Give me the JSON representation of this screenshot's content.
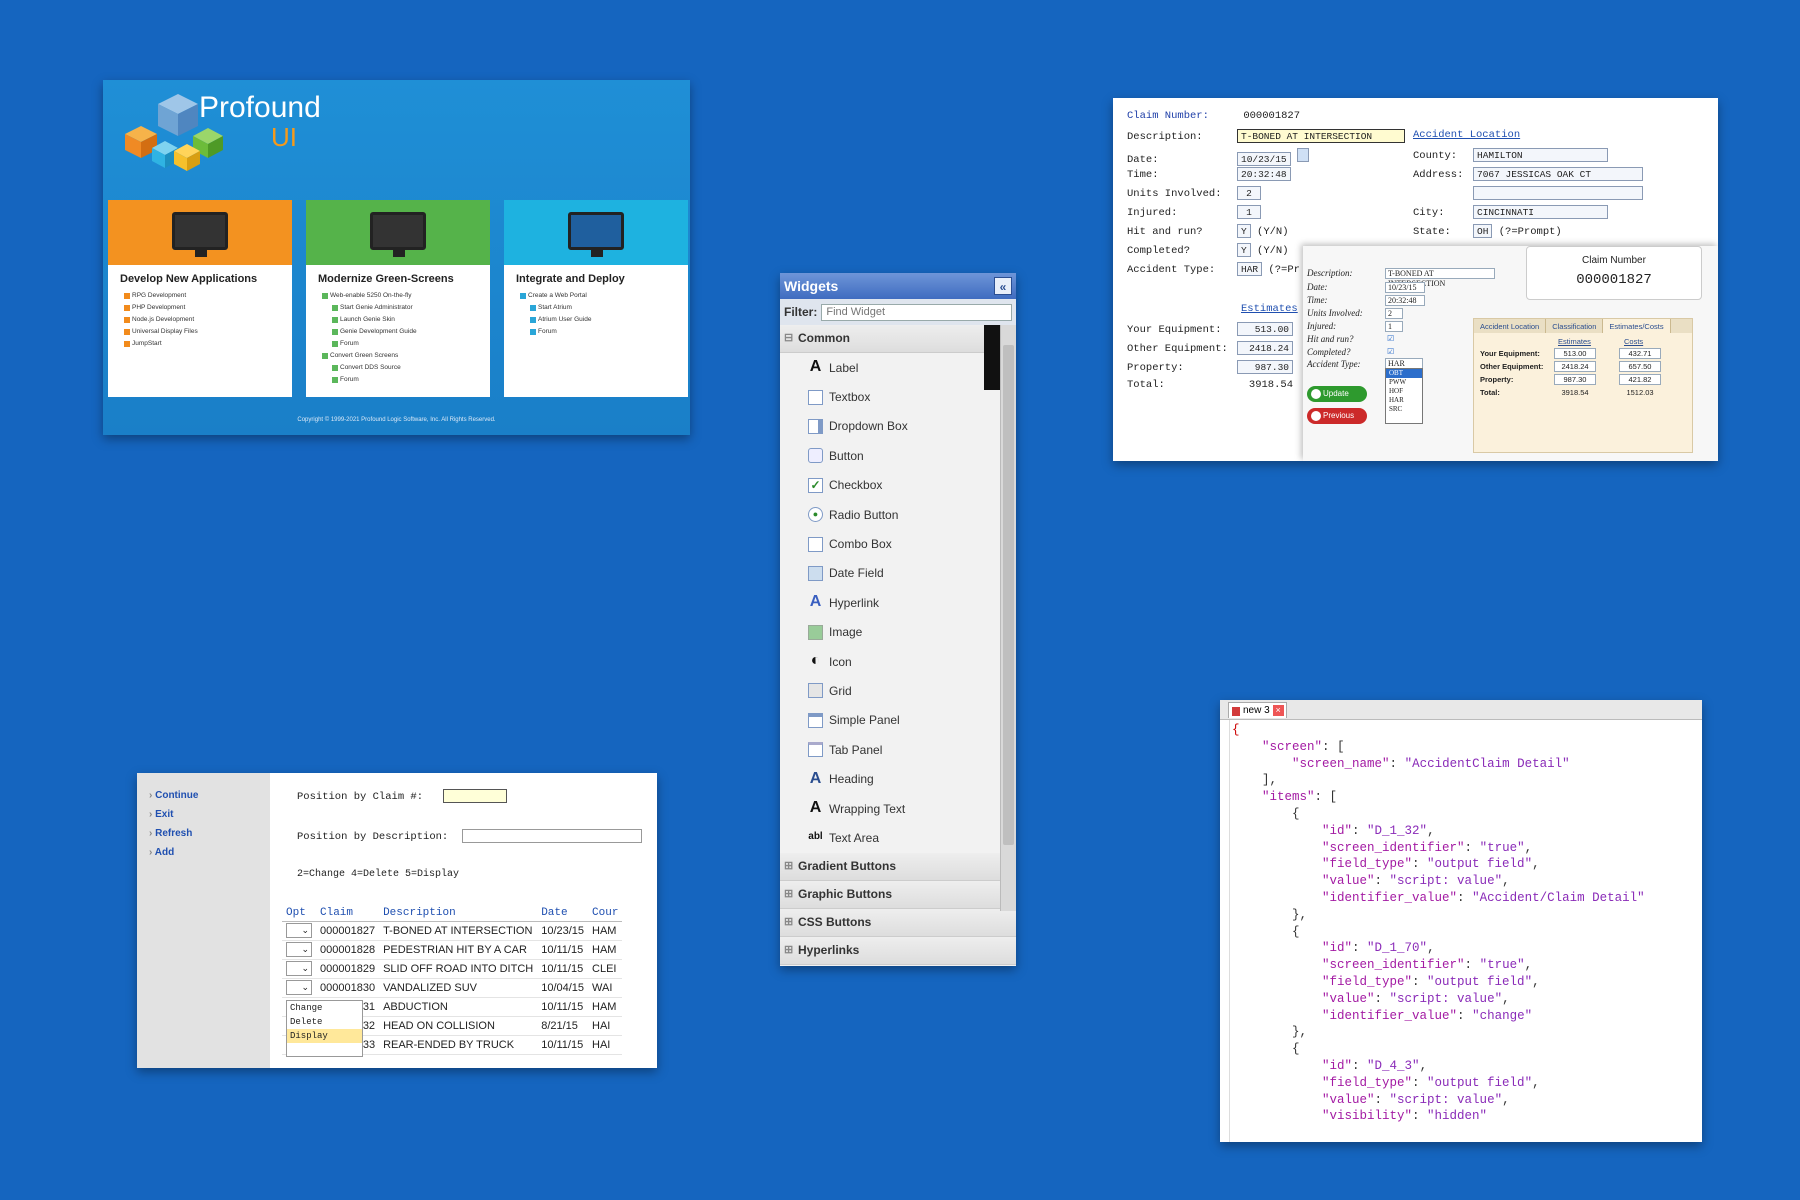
{
  "splash": {
    "brand_name": "Profound",
    "brand_suffix": "UI",
    "columns": [
      {
        "title": "Develop New Applications",
        "color": "#f39220",
        "items": [
          "RPG Development",
          "PHP Development",
          "Node.js Development",
          "Universal Display Files",
          "JumpStart"
        ]
      },
      {
        "title": "Modernize Green-Screens",
        "color": "#55b34a",
        "items": [
          "Web-enable 5250 On-the-fly",
          "Start Genie Administrator",
          "Launch Genie Skin",
          "Genie Development Guide",
          "Forum",
          "Convert Green Screens",
          "Convert DDS Source",
          "Forum"
        ]
      },
      {
        "title": "Integrate and Deploy",
        "color": "#1eb2e0",
        "items": [
          "Create a Web Portal",
          "Start Atrium",
          "Atrium User Guide",
          "Forum"
        ]
      }
    ],
    "copyright": "Copyright © 1999-2021 Profound Logic Software, Inc.    All Rights Reserved."
  },
  "widgets": {
    "title": "Widgets",
    "collapse_glyph": "«",
    "filter_label": "Filter:",
    "filter_placeholder": "Find Widget",
    "open_category": "Common",
    "items": [
      "Label",
      "Textbox",
      "Dropdown Box",
      "Button",
      "Checkbox",
      "Radio Button",
      "Combo Box",
      "Date Field",
      "Hyperlink",
      "Image",
      "Icon",
      "Grid",
      "Simple Panel",
      "Tab Panel",
      "Heading",
      "Wrapping Text",
      "Text Area"
    ],
    "categories": [
      "Gradient Buttons",
      "Graphic Buttons",
      "CSS Buttons",
      "Hyperlinks"
    ]
  },
  "claim_detail": {
    "claim_number_label": "Claim Number:",
    "claim_number": "000001827",
    "fields": [
      {
        "label": "Description:",
        "value": "T-BONED AT INTERSECTION"
      },
      {
        "label": "Date:",
        "value": "10/23/15"
      },
      {
        "label": "Time:",
        "value": "20:32:48"
      },
      {
        "label": "Units Involved:",
        "value": "2"
      },
      {
        "label": "Injured:",
        "value": "1"
      },
      {
        "label": "Hit and run?",
        "value": "Y",
        "suffix": "(Y/N)"
      },
      {
        "label": "Completed?",
        "value": "Y",
        "suffix": "(Y/N)"
      },
      {
        "label": "Accident Type:",
        "value": "HAR",
        "suffix": "(?=Pr"
      }
    ],
    "location_title": "Accident Location",
    "location": [
      {
        "label": "County:",
        "value": "HAMILTON"
      },
      {
        "label": "Address:",
        "value": "7067 JESSICAS OAK CT"
      },
      {
        "label": "",
        "value": ""
      },
      {
        "label": "City:",
        "value": "CINCINNATI"
      },
      {
        "label": "State:",
        "value": "OH",
        "suffix": "(?=Prompt)"
      }
    ],
    "estimates_title": "Estimates",
    "estimates": [
      {
        "label": "Your Equipment:",
        "value": "513.00"
      },
      {
        "label": "Other Equipment:",
        "value": "2418.24"
      },
      {
        "label": "Property:",
        "value": "987.30"
      },
      {
        "label": "Total:",
        "value": "3918.54"
      }
    ],
    "modern": {
      "rows": [
        {
          "label": "Description:",
          "value": "T-BONED AT INTERSECTION"
        },
        {
          "label": "Date:",
          "value": "10/23/15"
        },
        {
          "label": "Time:",
          "value": "20:32:48"
        },
        {
          "label": "Units Involved:",
          "value": "2"
        },
        {
          "label": "Injured:",
          "value": "1"
        },
        {
          "label": "Hit and run?",
          "value": "☑"
        },
        {
          "label": "Completed?",
          "value": "☑"
        },
        {
          "label": "Accident Type:",
          "value": "HAR"
        }
      ],
      "dropdown_options": [
        "OBT",
        "PWW",
        "HOF",
        "HAR",
        "SRC"
      ],
      "claim_box_title": "Claim Number",
      "claim_box_value": "000001827",
      "tabs": [
        "Accident Location",
        "Classification",
        "Estimates/Costs"
      ],
      "cost_headers": [
        "Estimates",
        "Costs"
      ],
      "cost_rows": [
        {
          "label": "Your Equipment:",
          "est": "513.00",
          "cost": "432.71"
        },
        {
          "label": "Other Equipment:",
          "est": "2418.24",
          "cost": "657.50"
        },
        {
          "label": "Property:",
          "est": "987.30",
          "cost": "421.82"
        },
        {
          "label": "Total:",
          "est": "3918.54",
          "cost": "1512.03"
        }
      ],
      "update_label": "Update",
      "previous_label": "Previous"
    }
  },
  "claim_list": {
    "nav": [
      "Continue",
      "Exit",
      "Refresh",
      "Add"
    ],
    "position_claim_label": "Position by Claim #:",
    "position_desc_label": "Position by Description:",
    "options_hint": "2=Change   4=Delete   5=Display",
    "headers": [
      "Opt",
      "Claim",
      "Description",
      "Date",
      "Cour"
    ],
    "rows": [
      {
        "claim": "000001827",
        "desc": "T-BONED AT INTERSECTION",
        "date": "10/23/15",
        "county": "HAM"
      },
      {
        "claim": "000001828",
        "desc": "PEDESTRIAN HIT BY A CAR",
        "date": "10/11/15",
        "county": "HAM"
      },
      {
        "claim": "000001829",
        "desc": "SLID OFF ROAD INTO DITCH",
        "date": "10/11/15",
        "county": "CLEI"
      },
      {
        "claim": "000001830",
        "desc": "VANDALIZED SUV",
        "date": "10/04/15",
        "county": "WAI"
      },
      {
        "claim": "31",
        "desc": "ABDUCTION",
        "date": "10/11/15",
        "county": "HAM"
      },
      {
        "claim": "32",
        "desc": "HEAD ON COLLISION",
        "date": "8/21/15",
        "county": "HAI"
      },
      {
        "claim": "000001833",
        "desc": "REAR-ENDED BY TRUCK",
        "date": "10/11/15",
        "county": "HAI"
      }
    ],
    "menu": [
      "Change",
      "Delete",
      "Display"
    ]
  },
  "json_editor": {
    "tab_name": "new 3",
    "close_glyph": "×"
  }
}
